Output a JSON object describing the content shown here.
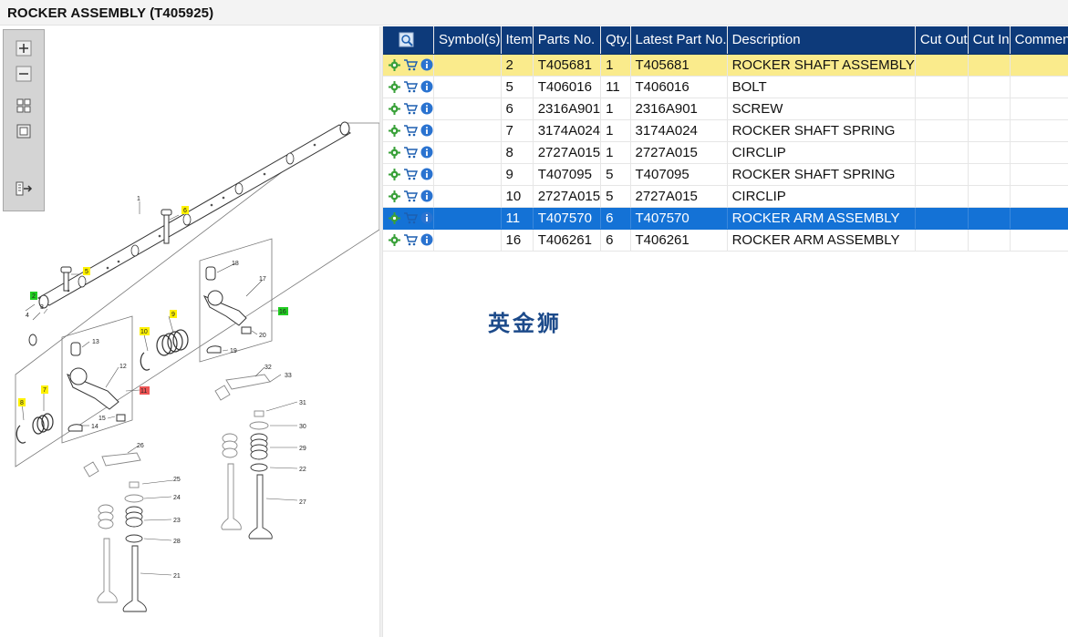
{
  "window": {
    "title": "ROCKER ASSEMBLY (T405925)"
  },
  "toolbox": {
    "buttons": [
      {
        "name": "zoom-in-button",
        "icon": "plus-icon"
      },
      {
        "name": "zoom-out-button",
        "icon": "minus-icon"
      },
      {
        "name": "fit-view-button",
        "icon": "grid-icon"
      },
      {
        "name": "actual-size-button",
        "icon": "square-icon"
      },
      {
        "name": "export-button",
        "icon": "export-icon"
      }
    ]
  },
  "diagram": {
    "callouts": [
      "1",
      "2",
      "3",
      "4",
      "5",
      "6",
      "7",
      "8",
      "9",
      "10",
      "11",
      "12",
      "13",
      "14",
      "15",
      "16",
      "17",
      "18",
      "19",
      "20",
      "21",
      "22",
      "23",
      "24",
      "25",
      "26",
      "27",
      "28",
      "29",
      "30",
      "31",
      "32",
      "33"
    ],
    "colors": {
      "yellow": "#fff200",
      "green": "#22cc22",
      "red": "#ee5555"
    }
  },
  "table": {
    "headers": {
      "symbols": "Symbol(s)",
      "item": "Item",
      "parts_no": "Parts No.",
      "qty": "Qty.",
      "latest": "Latest Part No.",
      "description": "Description",
      "cut_out": "Cut Out",
      "cut_in": "Cut In",
      "comment": "Comment"
    },
    "rows": [
      {
        "item": "2",
        "parts_no": "T405681",
        "qty": "1",
        "latest": "T405681",
        "description": "ROCKER SHAFT ASSEMBLY",
        "state": "highlight"
      },
      {
        "item": "5",
        "parts_no": "T406016",
        "qty": "11",
        "latest": "T406016",
        "description": "BOLT",
        "state": ""
      },
      {
        "item": "6",
        "parts_no": "2316A901",
        "qty": "1",
        "latest": "2316A901",
        "description": "SCREW",
        "state": ""
      },
      {
        "item": "7",
        "parts_no": "3174A024",
        "qty": "1",
        "latest": "3174A024",
        "description": "ROCKER SHAFT SPRING",
        "state": ""
      },
      {
        "item": "8",
        "parts_no": "2727A015",
        "qty": "1",
        "latest": "2727A015",
        "description": "CIRCLIP",
        "state": ""
      },
      {
        "item": "9",
        "parts_no": "T407095",
        "qty": "5",
        "latest": "T407095",
        "description": "ROCKER SHAFT SPRING",
        "state": ""
      },
      {
        "item": "10",
        "parts_no": "2727A015",
        "qty": "5",
        "latest": "2727A015",
        "description": "CIRCLIP",
        "state": ""
      },
      {
        "item": "11",
        "parts_no": "T407570",
        "qty": "6",
        "latest": "T407570",
        "description": "ROCKER ARM ASSEMBLY",
        "state": "selected"
      },
      {
        "item": "16",
        "parts_no": "T406261",
        "qty": "6",
        "latest": "T406261",
        "description": "ROCKER ARM ASSEMBLY",
        "state": ""
      }
    ]
  },
  "watermark": "英金狮",
  "accent": {
    "header_bg": "#0d3a7a",
    "selected_row": "#1472d6",
    "highlight_row": "#faeb8c"
  }
}
